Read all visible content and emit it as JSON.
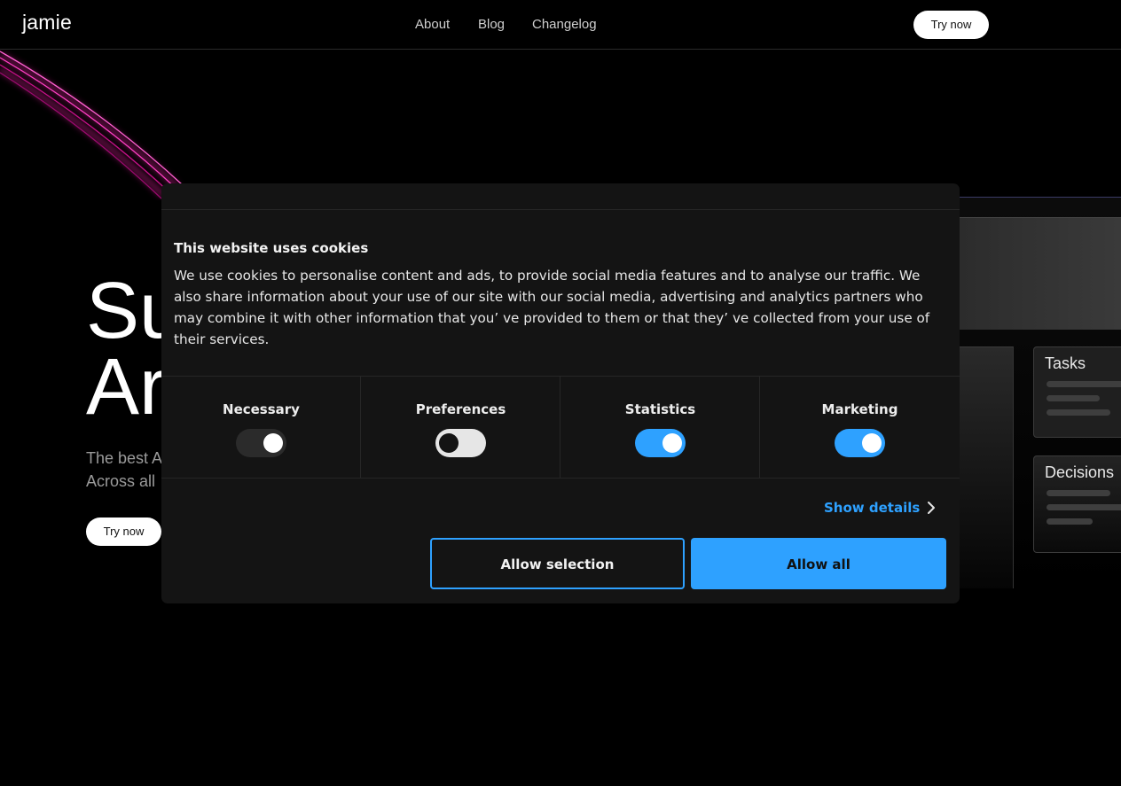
{
  "header": {
    "logo": "jamie",
    "nav": [
      "About",
      "Blog",
      "Changelog"
    ],
    "cta_label": "Try now"
  },
  "hero": {
    "title_line1": "Su",
    "title_line2": "Ar",
    "subtitle_line1": "The best A",
    "subtitle_line2": "Across all",
    "cta_label": "Try now"
  },
  "preview": {
    "cards": [
      {
        "title": "Tasks"
      },
      {
        "title": "Decisions"
      }
    ]
  },
  "cookie_dialog": {
    "heading": "This website uses cookies",
    "body": "We use cookies to personalise content and ads, to provide social media features and to analyse our traffic. We also share information about your use of our site with our social media, advertising and analytics partners who may combine it with other information that you’ ve provided to them or that they’ ve collected from your use of their services.",
    "toggles": [
      {
        "label": "Necessary",
        "state": "on",
        "locked": true
      },
      {
        "label": "Preferences",
        "state": "off",
        "locked": false
      },
      {
        "label": "Statistics",
        "state": "on",
        "locked": false
      },
      {
        "label": "Marketing",
        "state": "on",
        "locked": false
      }
    ],
    "show_details_label": "Show details",
    "allow_selection_label": "Allow selection",
    "allow_all_label": "Allow all"
  },
  "colors": {
    "accent": "#2ea1ff",
    "dialog_bg": "#141414",
    "arc_glow": "#e0209a"
  }
}
